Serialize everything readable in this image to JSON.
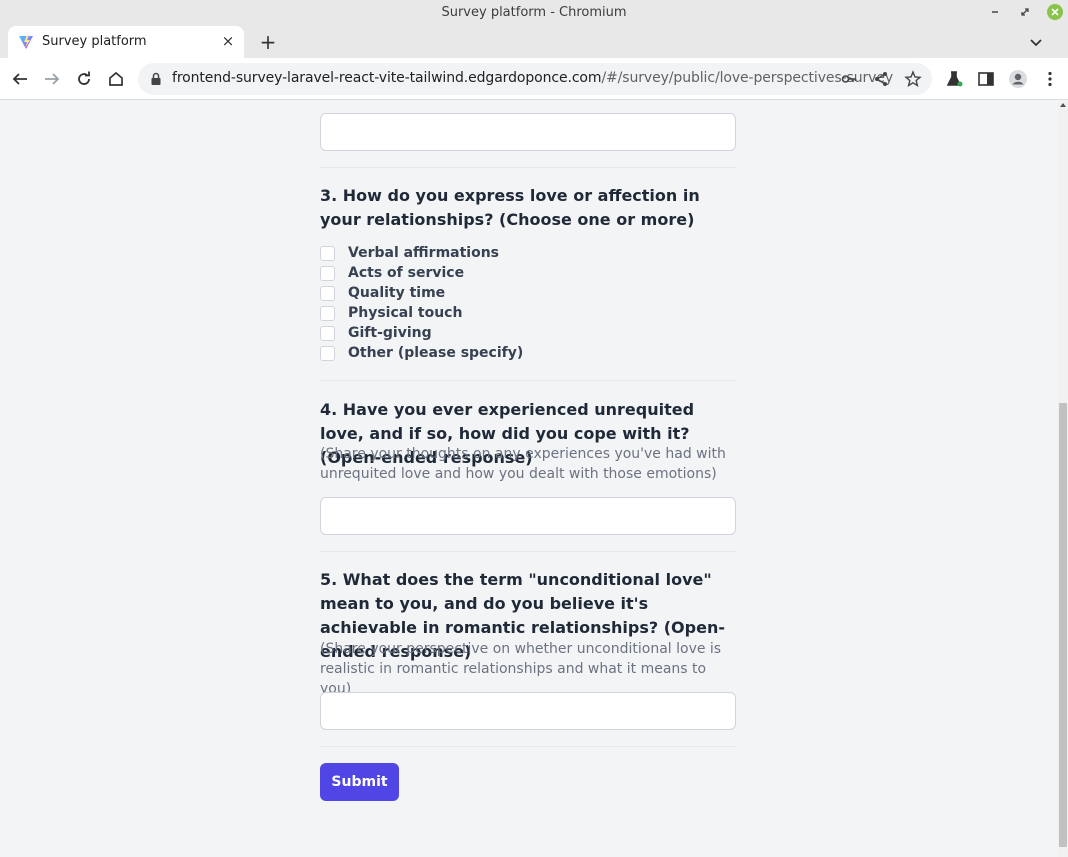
{
  "window": {
    "title": "Survey platform - Chromium"
  },
  "tab": {
    "title": "Survey platform"
  },
  "address_bar": {
    "url_host": "frontend-survey-laravel-react-vite-tailwind.edgardoponce.com",
    "url_path": "/#/survey/public/love-perspectives-survey"
  },
  "questions": [
    {
      "title": "3. How do you express love or affection in your relationships? (Choose one or more)",
      "type": "checkbox",
      "options": [
        {
          "label": "Verbal affirmations",
          "checked": false
        },
        {
          "label": "Acts of service",
          "checked": false
        },
        {
          "label": "Quality time",
          "checked": false
        },
        {
          "label": "Physical touch",
          "checked": false
        },
        {
          "label": "Gift-giving",
          "checked": false
        },
        {
          "label": "Other (please specify)",
          "checked": false
        }
      ]
    },
    {
      "title": "4. Have you ever experienced unrequited love, and if so, how did you cope with it? (Open-ended response)",
      "description": "(Share your thoughts on any experiences you've had with unrequited love and how you dealt with those emotions)",
      "type": "text",
      "value": ""
    },
    {
      "title": "5. What does the term \"unconditional love\" mean to you, and do you believe it's achievable in romantic relationships? (Open-ended response)",
      "description": "(Share your perspective on whether unconditional love is realistic in romantic relationships and what it means to you)",
      "type": "text",
      "value": ""
    }
  ],
  "previous_answer": {
    "value": ""
  },
  "submit": {
    "label": "Submit"
  },
  "colors": {
    "accent": "#4f46e5",
    "page_bg": "#f3f4f6"
  }
}
